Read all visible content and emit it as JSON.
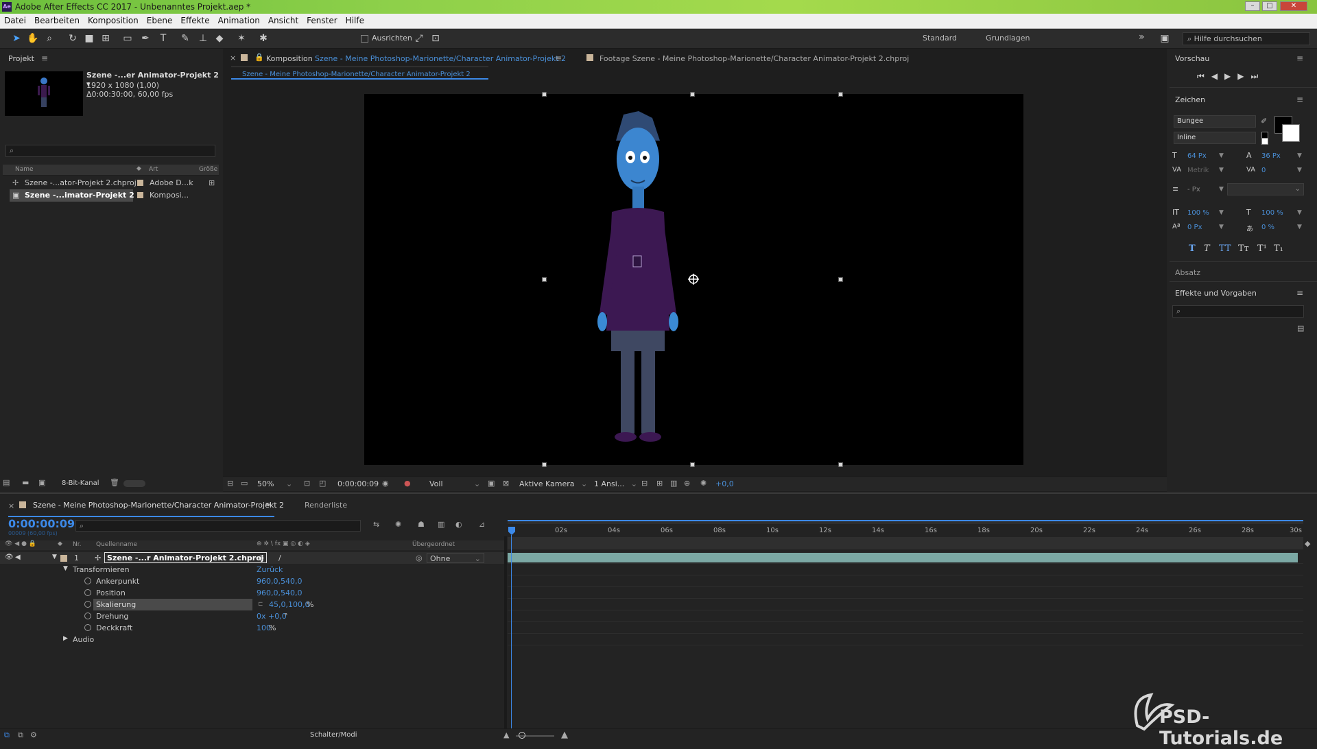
{
  "window": {
    "title": "Adobe After Effects CC 2017 - Unbenanntes Projekt.aep *",
    "app_icon": "Ae",
    "controls": [
      "minimize-icon",
      "maximize-icon",
      "close-icon"
    ]
  },
  "menu": [
    "Datei",
    "Bearbeiten",
    "Komposition",
    "Ebene",
    "Effekte",
    "Animation",
    "Ansicht",
    "Fenster",
    "Hilfe"
  ],
  "toolbar": {
    "align_label": "Ausrichten",
    "workspace_1": "Standard",
    "workspace_2": "Grundlagen",
    "expand": "»",
    "help_search": "Hilfe durchsuchen"
  },
  "project": {
    "title": "Projekt",
    "selected_name": "Szene -...er Animator-Projekt 2 ▾",
    "resolution": "1920 x 1080 (1,00)",
    "duration": "Δ0:00:30:00, 60,00 fps",
    "columns": {
      "name": "Name",
      "type": "Art",
      "size": "Größe"
    },
    "items": [
      {
        "name": "Szene -...ator-Projekt 2.chproj",
        "type": "Adobe D...k"
      },
      {
        "name": "Szene -...imator-Projekt 2",
        "type": "Komposi..."
      }
    ],
    "bit_depth": "8-Bit-Kanal"
  },
  "comp_viewer": {
    "tab_prefix": "Komposition",
    "tab_comp_name": "Szene - Meine Photoshop-Marionette/Character Animator-Projekt 2",
    "footage_tab": "Footage  Szene - Meine Photoshop-Marionette/Character Animator-Projekt 2.chproj",
    "sub_tab": "Szene - Meine Photoshop-Marionette/Character Animator-Projekt 2",
    "close": "×",
    "menu": "≡"
  },
  "comp_footer": {
    "zoom": "50%",
    "timecode": "0:00:00:09",
    "resolution": "Voll",
    "camera": "Aktive Kamera",
    "views": "1 Ansi...",
    "exposure": "+0,0"
  },
  "right_panel": {
    "preview_title": "Vorschau",
    "character_title": "Zeichen",
    "font": "Bungee",
    "font_style": "Inline",
    "font_size": "64 Px",
    "leading": "36 Px",
    "kerning": "Metrik",
    "tracking": "0",
    "stroke_unit": "- Px",
    "vert_scale": "100 %",
    "horiz_scale": "100 %",
    "baseline": "0 Px",
    "tsume": "0 %",
    "style_buttons": [
      "T",
      "T",
      "TT",
      "Tт",
      "T¹",
      "T₁"
    ],
    "paragraph_title": "Absatz",
    "effects_title": "Effekte und Vorgaben"
  },
  "timeline": {
    "tab_label": "Szene - Meine Photoshop-Marionette/Character Animator-Projekt 2",
    "render_tab": "Renderliste",
    "current_time": "0:00:00:09",
    "frames": "00009 (60,00 fps)",
    "col_nr": "Nr.",
    "col_source": "Quellenname",
    "col_parent": "Übergeordnet",
    "layer": {
      "number": "1",
      "name": "Szene -...r Animator-Projekt 2.chproj",
      "parent": "Ohne"
    },
    "transform_label": "Transformieren",
    "reset_label": "Zurück",
    "properties": [
      {
        "name": "Ankerpunkt",
        "value": "960,0,540,0"
      },
      {
        "name": "Position",
        "value": "960,0,540,0"
      },
      {
        "name": "Skalierung",
        "value": "45,0,100,0",
        "unit": "%"
      },
      {
        "name": "Drehung",
        "value": "0x +0,0",
        "unit": "°"
      },
      {
        "name": "Deckkraft",
        "value": "100",
        "unit": "%"
      }
    ],
    "audio_label": "Audio",
    "ruler": [
      "02s",
      "04s",
      "06s",
      "08s",
      "10s",
      "12s",
      "14s",
      "16s",
      "18s",
      "20s",
      "22s",
      "24s",
      "26s",
      "28s",
      "30s"
    ],
    "footer_toggle": "Schalter/Modi"
  },
  "watermark": "PSD-Tutorials.de",
  "colors": {
    "accent": "#4a90d9",
    "timecode": "#3c89e8",
    "layer_bar": "#7ba8a4"
  }
}
